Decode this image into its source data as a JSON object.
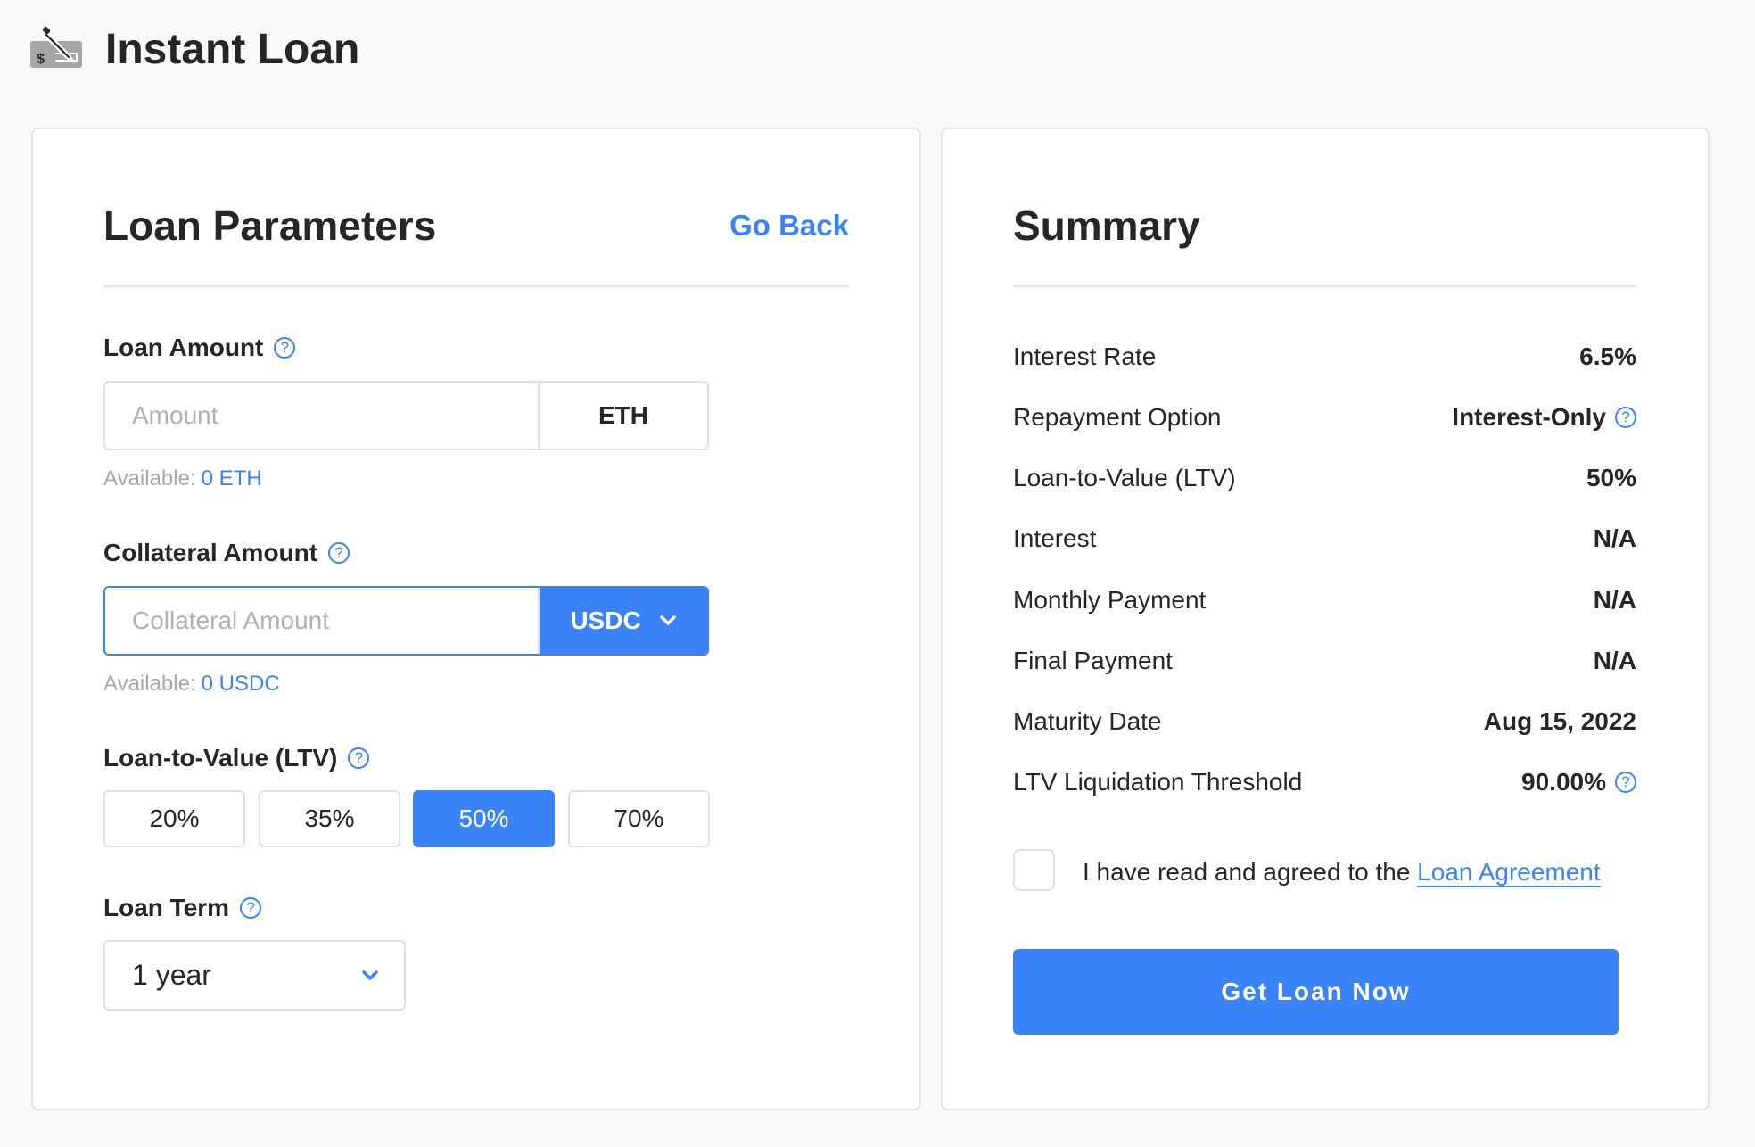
{
  "header": {
    "title": "Instant Loan",
    "icon": "check-pen-icon"
  },
  "colors": {
    "accent": "#3a83f6",
    "background": "#f8f8f8",
    "text": "#262626",
    "border": "#e2e5e9",
    "muted": "#a9a9a9"
  },
  "loan_parameters": {
    "title": "Loan Parameters",
    "go_back": "Go Back",
    "loan_amount": {
      "label": "Loan Amount",
      "placeholder": "Amount",
      "value": "",
      "currency": "ETH",
      "available_label": "Available:",
      "available_value": "0 ETH"
    },
    "collateral_amount": {
      "label": "Collateral Amount",
      "placeholder": "Collateral Amount",
      "value": "",
      "currency": "USDC",
      "available_label": "Available:",
      "available_value": "0 USDC"
    },
    "ltv": {
      "label": "Loan-to-Value (LTV)",
      "options": [
        "20%",
        "35%",
        "50%",
        "70%"
      ],
      "selected": "50%"
    },
    "loan_term": {
      "label": "Loan Term",
      "selected": "1 year"
    }
  },
  "summary": {
    "title": "Summary",
    "rows": [
      {
        "label": "Interest Rate",
        "value": "6.5%"
      },
      {
        "label": "Repayment Option",
        "value": "Interest-Only",
        "help": true
      },
      {
        "label": "Loan-to-Value (LTV)",
        "value": "50%"
      },
      {
        "label": "Interest",
        "value": "N/A"
      },
      {
        "label": "Monthly Payment",
        "value": "N/A"
      },
      {
        "label": "Final Payment",
        "value": "N/A"
      },
      {
        "label": "Maturity Date",
        "value": "Aug 15, 2022"
      },
      {
        "label": "LTV Liquidation Threshold",
        "value": "90.00%",
        "help": true
      }
    ],
    "agreement_text": "I have read and agreed to the",
    "agreement_link": "Loan Agreement",
    "agreement_checked": false,
    "submit_label": "Get Loan Now"
  },
  "help_glyph": "?",
  "chevron_glyph": "⌄"
}
